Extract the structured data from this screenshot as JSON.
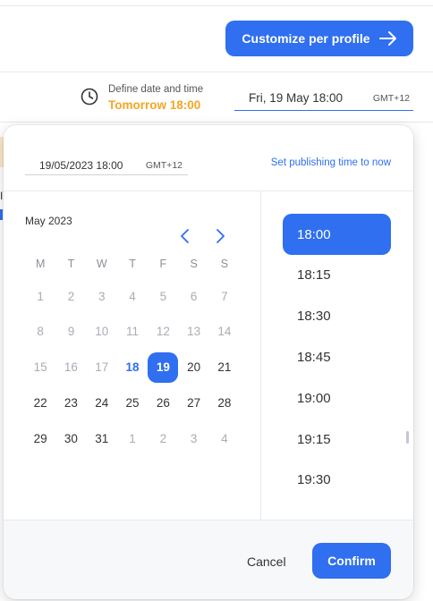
{
  "header": {
    "customize_label": "Customize per profile",
    "customize_icon": "arrow-right-icon"
  },
  "schedule": {
    "define_label": "Define date and time",
    "define_value": "Tomorrow 18:00",
    "date_value": "Fri, 19 May 18:00",
    "timezone": "GMT+12",
    "clock_icon": "clock-icon"
  },
  "left_stub": {
    "text": "I"
  },
  "picker": {
    "input_value": "19/05/2023 18:00",
    "input_tz": "GMT+12",
    "set_now_label": "Set publishing time to now",
    "month_label": "May 2023",
    "weekdays": [
      "M",
      "T",
      "W",
      "T",
      "F",
      "S",
      "S"
    ],
    "weeks": [
      [
        "1",
        "2",
        "3",
        "4",
        "5",
        "6",
        "7"
      ],
      [
        "8",
        "9",
        "10",
        "11",
        "12",
        "13",
        "14"
      ],
      [
        "15",
        "16",
        "17",
        "18",
        "19",
        "20",
        "21"
      ],
      [
        "22",
        "23",
        "24",
        "25",
        "26",
        "27",
        "28"
      ],
      [
        "29",
        "30",
        "31",
        "1",
        "2",
        "3",
        "4"
      ]
    ],
    "today": "18",
    "selected_day": "19",
    "times": [
      "18:00",
      "18:15",
      "18:30",
      "18:45",
      "19:00",
      "19:15",
      "19:30"
    ],
    "selected_time": "18:00",
    "cancel_label": "Cancel",
    "confirm_label": "Confirm"
  },
  "colors": {
    "accent": "#2f6ff0",
    "highlight": "#f5a623"
  }
}
